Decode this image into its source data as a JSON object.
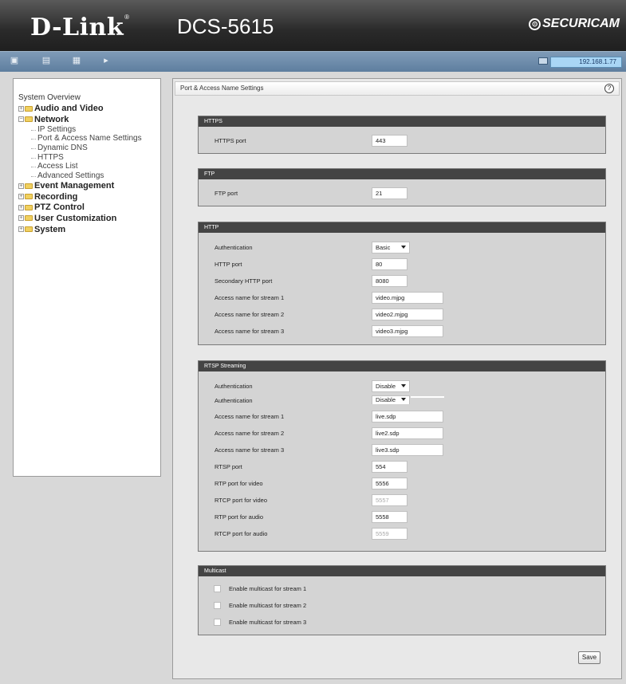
{
  "header": {
    "logo": "D-Link",
    "logo_mark": "®",
    "model": "DCS-5615",
    "brand": "SECURICAM"
  },
  "toolbar": {
    "icons": [
      "camera-icon",
      "playback-icon",
      "settings-icon",
      "logout-icon"
    ],
    "ip_address": "192.168.1.77"
  },
  "sidebar": {
    "title": "System Overview",
    "sections": [
      {
        "label": "Audio and Video",
        "expanded": false
      },
      {
        "label": "Network",
        "expanded": true,
        "children": [
          "IP Settings",
          "Port & Access Name Settings",
          "Dynamic DNS",
          "HTTPS",
          "Access List",
          "Advanced Settings"
        ]
      },
      {
        "label": "Event Management",
        "expanded": false
      },
      {
        "label": "Recording",
        "expanded": false
      },
      {
        "label": "PTZ Control",
        "expanded": false
      },
      {
        "label": "User Customization",
        "expanded": false
      },
      {
        "label": "System",
        "expanded": false
      }
    ]
  },
  "main": {
    "title": "Port & Access Name Settings",
    "help": "?",
    "https": {
      "header": "HTTPS",
      "port_label": "HTTPS port",
      "port_value": "443"
    },
    "ftp": {
      "header": "FTP",
      "port_label": "FTP port",
      "port_value": "21"
    },
    "http": {
      "header": "HTTP",
      "rows": [
        {
          "label": "Authentication",
          "value": "Basic",
          "type": "select"
        },
        {
          "label": "HTTP port",
          "value": "80",
          "type": "input-sm"
        },
        {
          "label": "Secondary HTTP port",
          "value": "8080",
          "type": "input-sm"
        },
        {
          "label": "Access name for stream 1",
          "value": "video.mjpg",
          "type": "input-lg"
        },
        {
          "label": "Access name for stream 2",
          "value": "video2.mjpg",
          "type": "input-lg"
        },
        {
          "label": "Access name for stream 3",
          "value": "video3.mjpg",
          "type": "input-lg"
        }
      ]
    },
    "rtsp": {
      "header": "RTSP Streaming",
      "rows": [
        {
          "label": "Authentication",
          "value": "Disable",
          "type": "select"
        },
        {
          "label": "Authentication",
          "value": "Disable",
          "type": "select"
        },
        {
          "label": "Access name for stream 1",
          "value": "live.sdp",
          "type": "input-lg"
        },
        {
          "label": "Access name for stream 2",
          "value": "live2.sdp",
          "type": "input-lg"
        },
        {
          "label": "Access name for stream 3",
          "value": "live3.sdp",
          "type": "input-lg"
        },
        {
          "label": "RTSP port",
          "value": "554",
          "type": "input-sm"
        },
        {
          "label": "RTP port for video",
          "value": "5556",
          "type": "input-sm"
        },
        {
          "label": "RTCP port for video",
          "value": "5557",
          "type": "input-sm-disabled"
        },
        {
          "label": "RTP port for audio",
          "value": "5558",
          "type": "input-sm"
        },
        {
          "label": "RTCP port for audio",
          "value": "5559",
          "type": "input-sm-disabled"
        }
      ]
    },
    "multicast": {
      "header": "Multicast",
      "options": [
        "Enable multicast for stream 1",
        "Enable multicast for stream 2",
        "Enable multicast for stream 3"
      ]
    },
    "save_label": "Save"
  }
}
